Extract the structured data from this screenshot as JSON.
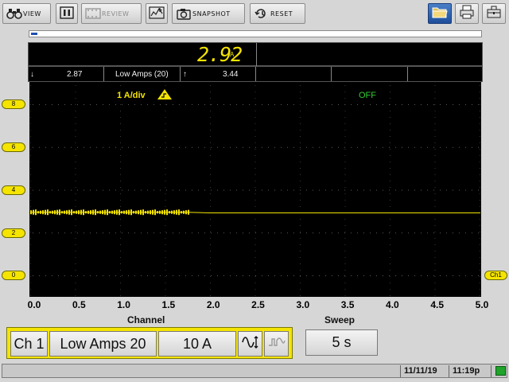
{
  "toolbar": {
    "view_label": "VIEW",
    "review_label": "REVIEW",
    "snapshot_label": "SNAPSHOT",
    "reset_label": "RESET"
  },
  "readout": {
    "value": "2.92",
    "unit": "A",
    "min_value": "2.87",
    "channel_label": "Low Amps (20)",
    "max_value": "3.44"
  },
  "plot": {
    "scale_label": "1 A/div",
    "trigger_status": "OFF",
    "y_labels": [
      "8",
      "6",
      "4",
      "2",
      "0"
    ],
    "channel_tag": "Ch1"
  },
  "x_axis": {
    "ticks": [
      "0.0",
      "0.5",
      "1.0",
      "1.5",
      "2.0",
      "2.5",
      "3.0",
      "3.5",
      "4.0",
      "4.5",
      "5.0"
    ]
  },
  "controls": {
    "channel_heading": "Channel",
    "sweep_heading": "Sweep",
    "channel": "Ch 1",
    "probe": "Low Amps 20",
    "range": "10 A",
    "sweep": "5 s"
  },
  "status": {
    "date": "11/11/19",
    "time": "11:19p"
  },
  "colors": {
    "trace": "#f5e400",
    "off_text": "#33cc33",
    "accent": "#f5e400"
  },
  "chart_data": {
    "type": "line",
    "x_range": [
      0,
      5
    ],
    "y_range": [
      0,
      10
    ],
    "series": [
      {
        "x": [
          0,
          0.5,
          1.0,
          1.5,
          1.75,
          2.0,
          2.5,
          3.0,
          3.5,
          4.0,
          4.5,
          5.0
        ],
        "values": [
          2.95,
          2.95,
          2.95,
          2.95,
          2.95,
          2.92,
          2.92,
          2.92,
          2.92,
          2.92,
          2.92,
          2.92
        ]
      }
    ]
  },
  "progress_fraction": 0.015
}
